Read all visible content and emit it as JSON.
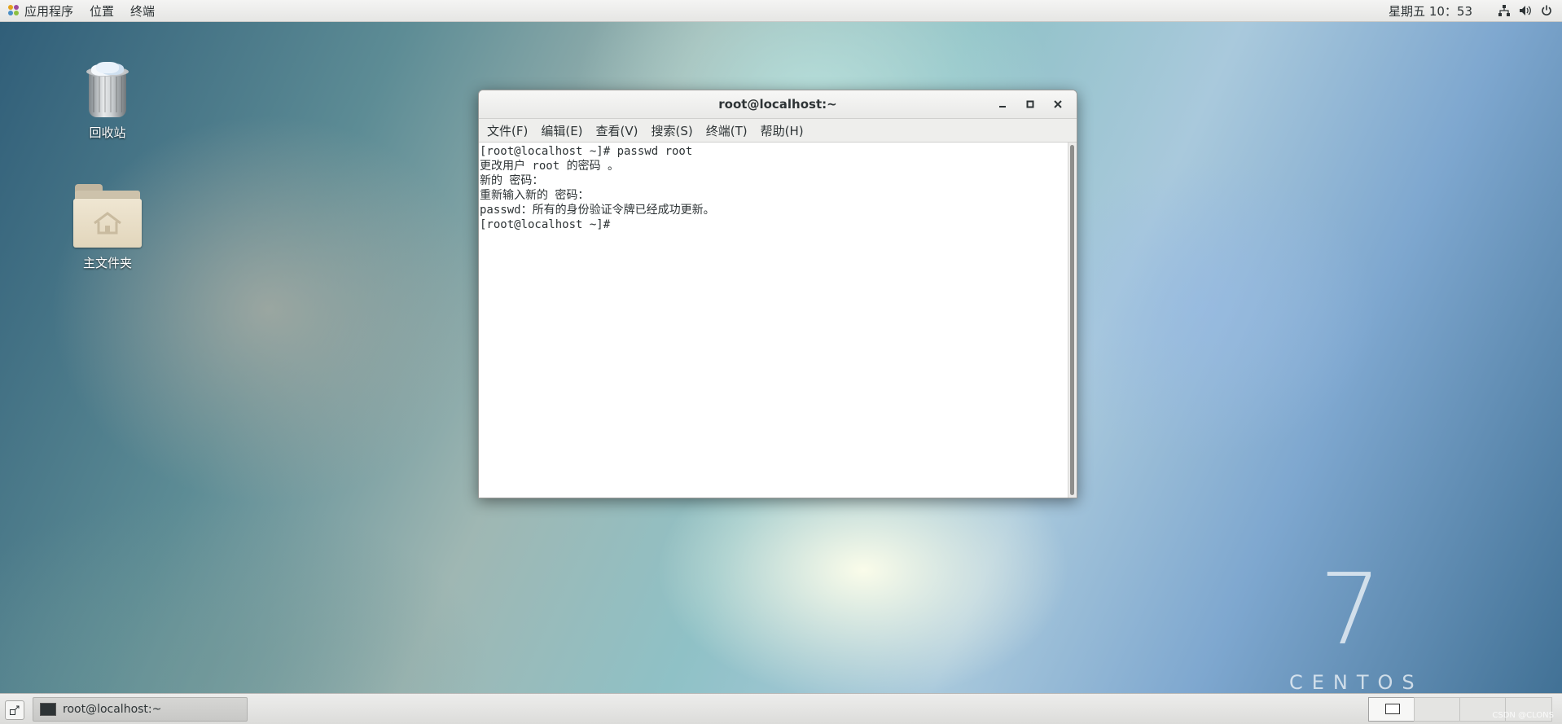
{
  "topbar": {
    "apps_menu": "应用程序",
    "places_menu": "位置",
    "terminal_menu": "终端",
    "clock": "星期五 10：53",
    "tray_icons": [
      "network-icon",
      "volume-icon",
      "power-icon"
    ]
  },
  "desktop": {
    "icons": [
      {
        "label": "回收站",
        "icon": "trash-icon"
      },
      {
        "label": "主文件夹",
        "icon": "home-folder-icon"
      }
    ],
    "watermark": {
      "number": "7",
      "text": "CENTOS"
    }
  },
  "terminal_window": {
    "title": "root@localhost:~",
    "menu": [
      "文件(F)",
      "编辑(E)",
      "查看(V)",
      "搜索(S)",
      "终端(T)",
      "帮助(H)"
    ],
    "lines": [
      "[root@localhost ~]# passwd root",
      "更改用户 root 的密码 。",
      "新的 密码：",
      "重新输入新的 密码：",
      "passwd：所有的身份验证令牌已经成功更新。",
      "[root@localhost ~]#"
    ]
  },
  "taskbar": {
    "window_button_label": "root@localhost:~",
    "watermark": "CSDN @CLONS"
  }
}
